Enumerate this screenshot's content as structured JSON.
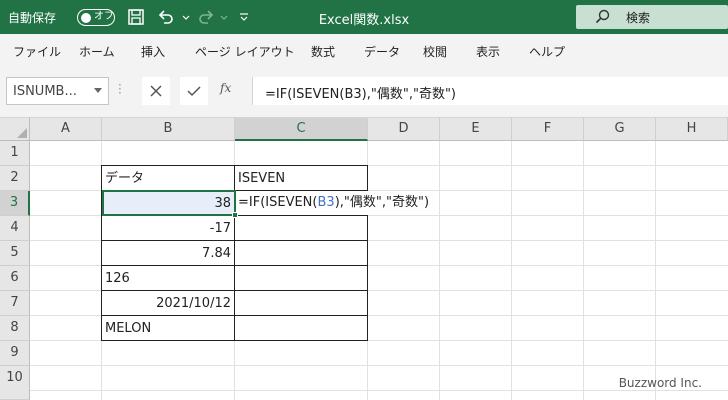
{
  "titlebar": {
    "autosave_label": "自動保存",
    "autosave_state": "オフ",
    "filename": "Excel関数.xlsx",
    "search_placeholder": "検索",
    "bg_color": "#217346"
  },
  "ribbon": {
    "tabs": [
      "ファイル",
      "ホーム",
      "挿入",
      "ページ レイアウト",
      "数式",
      "データ",
      "校閲",
      "表示",
      "ヘルプ"
    ]
  },
  "formula_bar": {
    "name_box": "ISNUMB...",
    "fx_label": "fx",
    "formula": "=IF(ISEVEN(B3),\"偶数\",\"奇数\")"
  },
  "grid": {
    "columns": [
      "A",
      "B",
      "C",
      "D",
      "E",
      "F",
      "G",
      "H"
    ],
    "rows": [
      "1",
      "2",
      "3",
      "4",
      "5",
      "6",
      "7",
      "8",
      "9",
      "10"
    ],
    "selected_column": "C",
    "selected_row": "3",
    "cells": {
      "B2": "データ",
      "C2": "ISEVEN",
      "B3": "38",
      "B4": "-17",
      "B5": "7.84",
      "B6": "126",
      "B7": "2021/10/12",
      "B8": "MELON"
    },
    "edit": {
      "pre": "=IF(ISEVEN(",
      "ref": "B3",
      "post": "),\"偶数\",\"奇数\")"
    },
    "reference_color": "#4472c4"
  },
  "watermark": "Buzzword Inc."
}
